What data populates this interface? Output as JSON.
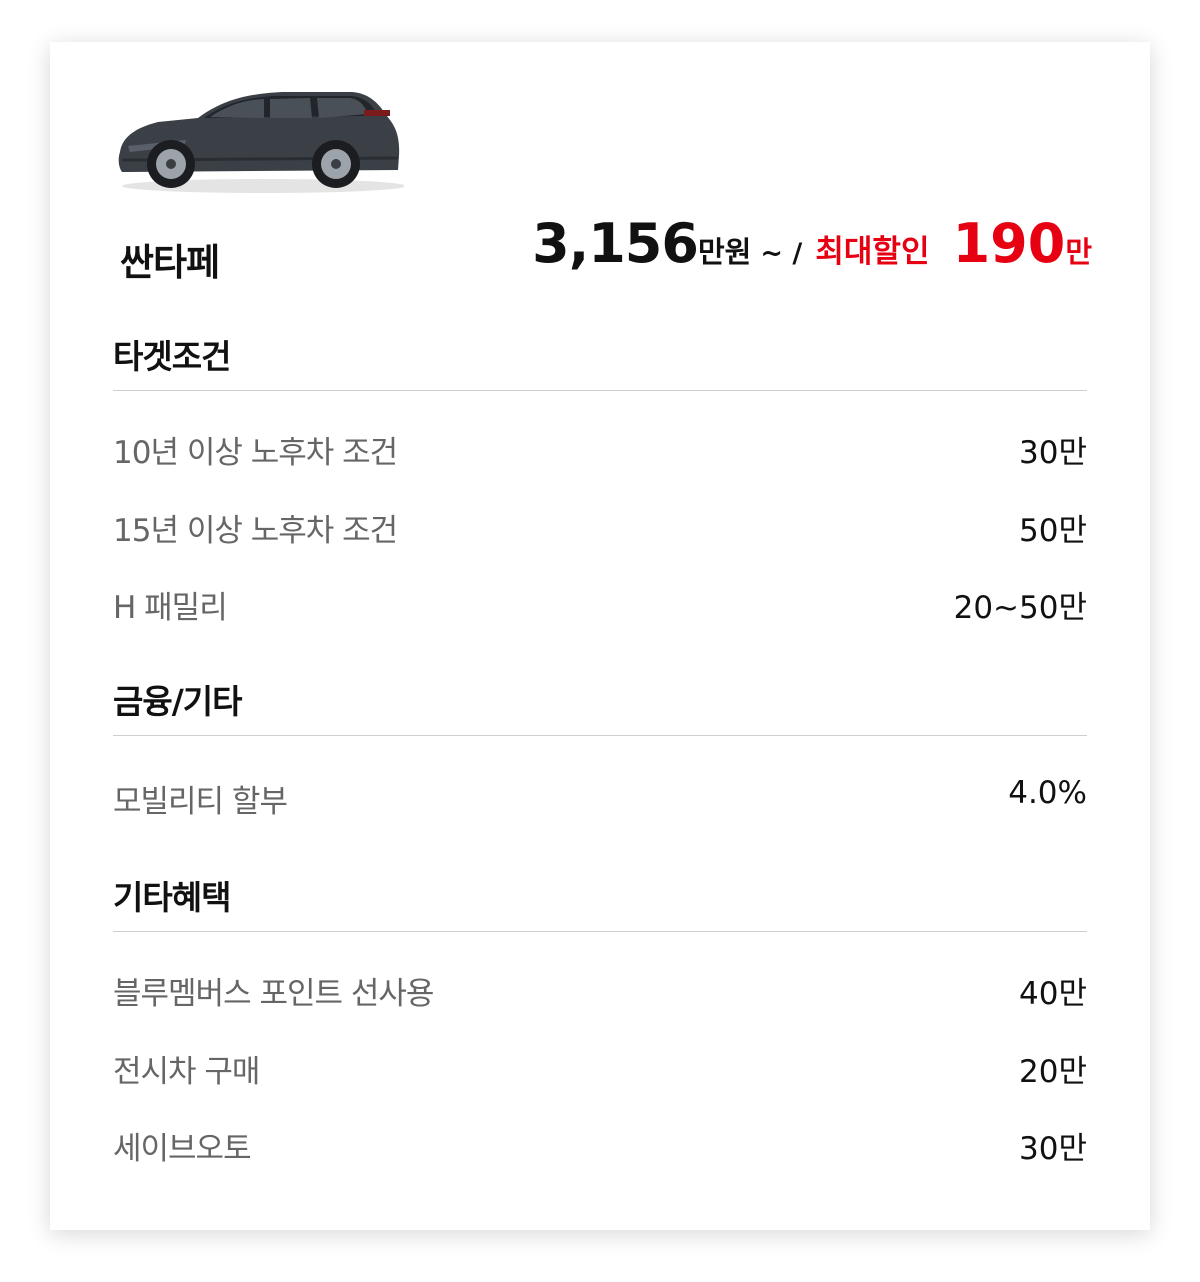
{
  "model": {
    "name": "싼타페",
    "image_icon": "suv-car-icon",
    "price": "3,156",
    "price_unit": "만원",
    "separator": "~ /",
    "discount_label": "최대할인",
    "discount_value": "190",
    "discount_unit": "만"
  },
  "colors": {
    "accent": "#e60012",
    "label": "#666666",
    "value": "#111111",
    "divider": "#cfcfcf"
  },
  "sections": [
    {
      "title": "타겟조건",
      "rows": [
        {
          "label": "10년 이상 노후차 조건",
          "value": "30만"
        },
        {
          "label": "15년 이상 노후차 조건",
          "value": "50만"
        },
        {
          "label": "H 패밀리",
          "value": "20~50만"
        }
      ]
    },
    {
      "title": "금융/기타",
      "rows": [
        {
          "label": "모빌리티 할부",
          "value": "4.0%"
        }
      ]
    },
    {
      "title": "기타혜택",
      "rows": [
        {
          "label": "블루멤버스 포인트 선사용",
          "value": "40만"
        },
        {
          "label": "전시차 구매",
          "value": "20만"
        },
        {
          "label": "세이브오토",
          "value": "30만"
        }
      ]
    }
  ]
}
